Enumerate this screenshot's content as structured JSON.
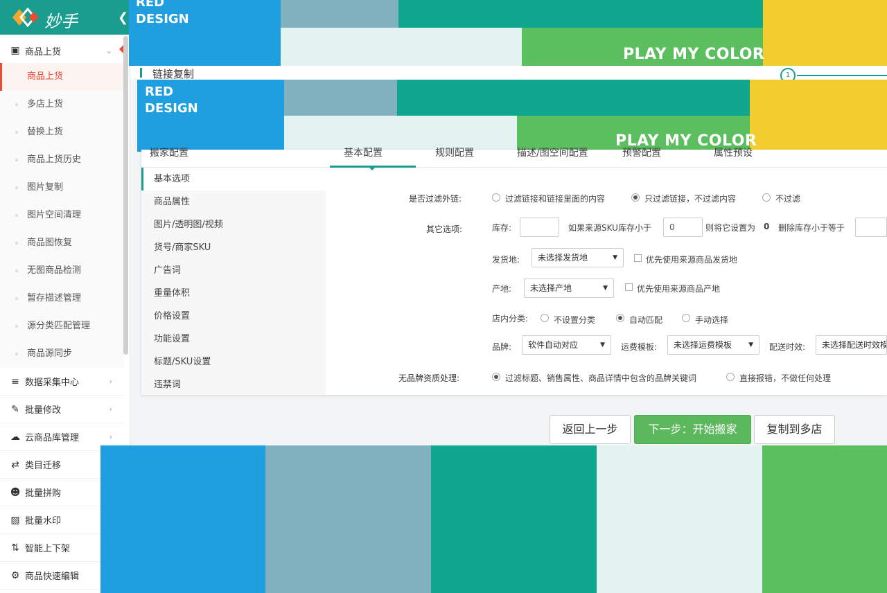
{
  "brand": {
    "name": "妙手"
  },
  "sidebar": {
    "group_label": "商品上货",
    "subitems": [
      "商品上货",
      "多店上货",
      "替换上货",
      "商品上货历史",
      "图片复制",
      "图片空间清理",
      "商品图恢复",
      "无图商品检测",
      "暂存描述管理",
      "源分类匹配管理",
      "商品源同步"
    ],
    "active_subitem": 0,
    "lower_items": [
      {
        "label": "数据采集中心",
        "icon": "database-icon",
        "has_chevron": true
      },
      {
        "label": "批量修改",
        "icon": "edit-icon",
        "has_chevron": true
      },
      {
        "label": "云商品库管理",
        "icon": "cloud-icon",
        "has_chevron": true
      },
      {
        "label": "类目迁移",
        "icon": "swap-icon",
        "has_chevron": false
      },
      {
        "label": "批量拼购",
        "icon": "users-icon",
        "has_chevron": false
      },
      {
        "label": "批量水印",
        "icon": "image-icon",
        "has_chevron": false
      },
      {
        "label": "智能上下架",
        "icon": "sort-icon",
        "has_chevron": false
      },
      {
        "label": "商品快速编辑",
        "icon": "gears-icon",
        "has_chevron": false
      }
    ]
  },
  "overlay": {
    "red_design": "RED\nDESIGN",
    "play_my_color": "PLAY MY COLOR",
    "colors": {
      "blue": "#1f9fdf",
      "gray": "#7fb1bf",
      "teal": "#0fa88e",
      "pale": "#e2f3f1",
      "green": "#5cbf5f",
      "yellow": "#f2cd2e"
    }
  },
  "link_section": {
    "title": "链接复制",
    "step_number": "1"
  },
  "panel": {
    "head_fragments": [
      "搬家配置",
      "基本配置",
      "规则配置",
      "描述/图空间配置",
      "预警配置",
      "属性预设"
    ],
    "nav_items": [
      "基本选项",
      "商品属性",
      "图片/透明图/视频",
      "货号/商家SKU",
      "广告词",
      "重量体积",
      "价格设置",
      "功能设置",
      "标题/SKU设置",
      "违禁词"
    ],
    "active_nav": 0
  },
  "form": {
    "filter_links": {
      "label": "是否过滤外链:",
      "options": [
        "过滤链接和链接里面的内容",
        "只过滤链接，不过滤内容",
        "不过滤"
      ],
      "selected": 1
    },
    "other_options": {
      "label": "其它选项:",
      "stock_label": "库存:",
      "stock_value": "",
      "if_source_less": "如果来源SKU库存小于",
      "source_threshold": "0",
      "then_set": "则将它设置为",
      "set_value": "0",
      "delete_less": "删除库存小于等于",
      "delete_value": ""
    },
    "ship_from": {
      "label": "发货地:",
      "value": "未选择发货地",
      "check_label": "优先使用来源商品发货地"
    },
    "origin": {
      "label": "产地:",
      "value": "未选择产地",
      "check_label": "优先使用来源商品产地"
    },
    "shop_category": {
      "label": "店内分类:",
      "options": [
        "不设置分类",
        "自动匹配",
        "手动选择"
      ],
      "selected": 1
    },
    "brand": {
      "label": "品牌:",
      "value": "软件自动对应"
    },
    "freight": {
      "label": "运费模板:",
      "value": "未选择运费模板"
    },
    "delivery": {
      "label": "配送时效:",
      "value": "未选择配送时效模"
    },
    "no_brand": {
      "label": "无品牌资质处理:",
      "options": [
        "过滤标题、销售属性、商品详情中包含的品牌关键词",
        "直接报错，不做任何处理"
      ],
      "selected": 0
    }
  },
  "buttons": {
    "back": "返回上一步",
    "next": "下一步：开始搬家",
    "copy_multi": "复制到多店"
  }
}
